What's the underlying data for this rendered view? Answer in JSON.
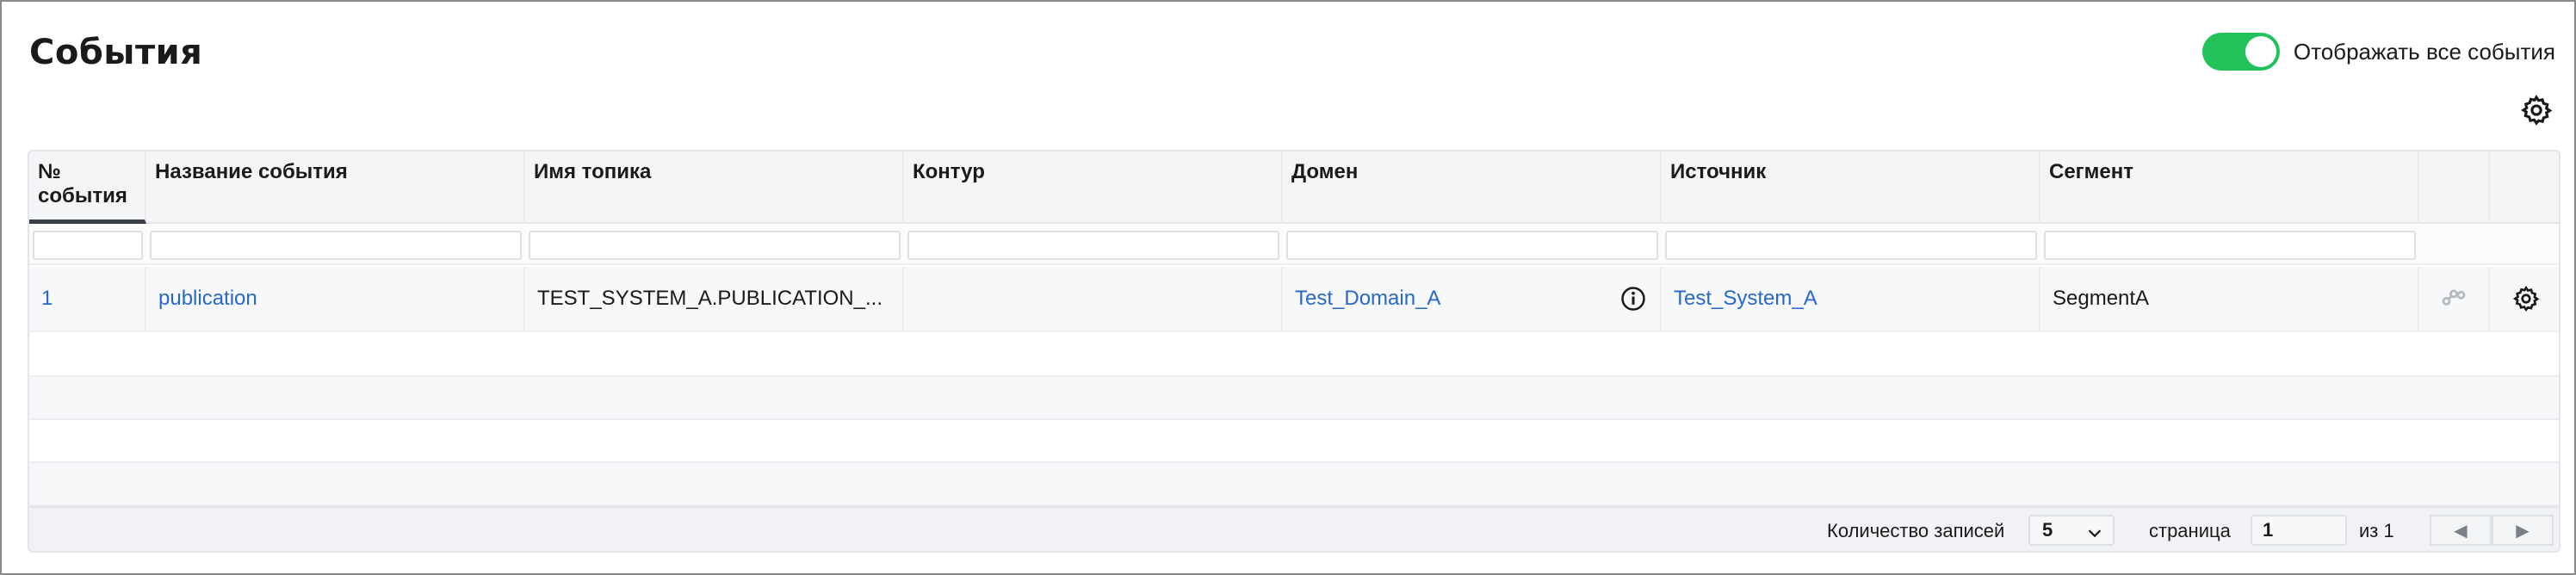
{
  "header": {
    "title": "События",
    "toggle_label": "Отображать все события",
    "toggle_on": true
  },
  "colors": {
    "accent_green": "#22c25a",
    "link_blue": "#2868c8"
  },
  "table": {
    "columns": [
      "№ события",
      "Название события",
      "Имя топика",
      "Контур",
      "Домен",
      "Источник",
      "Сегмент"
    ],
    "rows": [
      {
        "number": "1",
        "event_name": "publication",
        "topic": "TEST_SYSTEM_A.PUBLICATION_...",
        "contour": "",
        "domain": "Test_Domain_A",
        "source": "Test_System_A",
        "segment": "SegmentA"
      }
    ]
  },
  "footer": {
    "records_label": "Количество записей",
    "records_value": "5",
    "page_label": "страница",
    "page_value": "1",
    "of_label": "из 1",
    "prev_icon": "◀",
    "next_icon": "▶"
  }
}
